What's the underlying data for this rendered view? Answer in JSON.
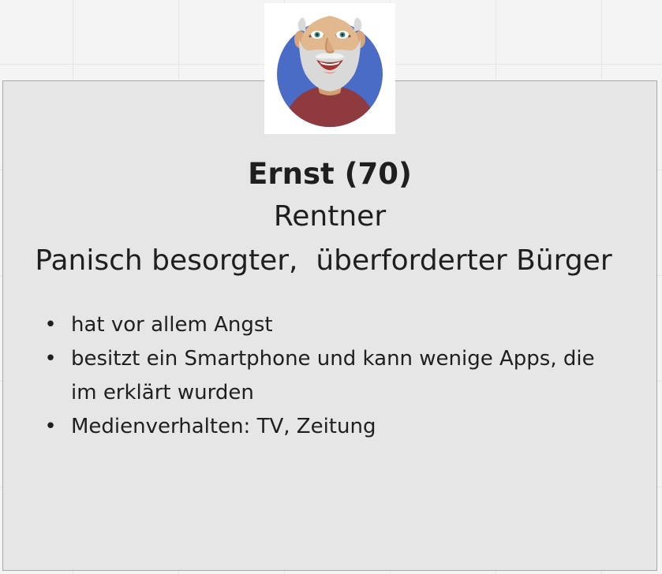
{
  "persona": {
    "title": "Ernst (70)",
    "occupation": "Rentner",
    "tagline": "Panisch besorgter,  überforderter Bürger",
    "avatar_icon": "elderly-man-avatar-icon",
    "traits": [
      "hat vor allem Angst",
      "besitzt ein Smartphone und kann wenige Apps, die im erklärt wurden",
      "Medienverhalten: TV, Zeitung"
    ]
  },
  "colors": {
    "canvas": "#f4f4f4",
    "grid": "#e5e5e5",
    "card": "#e6e6e6",
    "card_border": "#a8a8a8",
    "text": "#1f1f1f",
    "avatar_background": "#4a6bc6",
    "avatar_shirt": "#8f3a3f",
    "avatar_skin": "#e2b88f",
    "avatar_beard": "#d9d9d9"
  }
}
